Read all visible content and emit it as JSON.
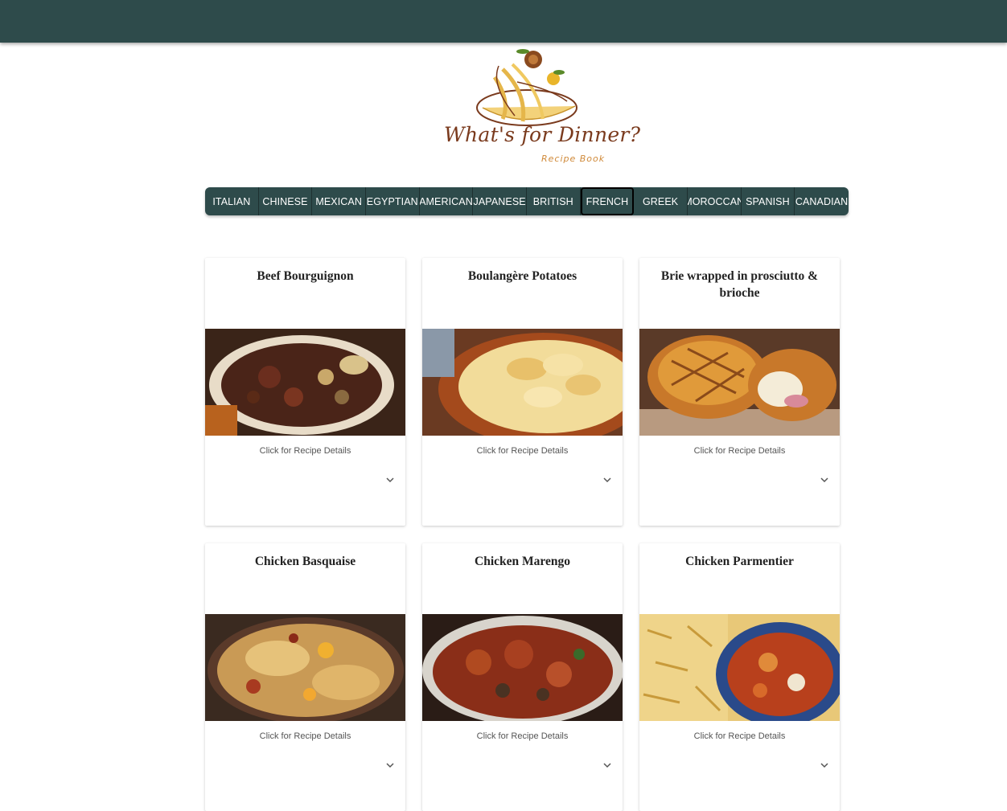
{
  "logo": {
    "title": "What's for Dinner?",
    "subtitle": "Recipe Book"
  },
  "tabs": [
    "ITALIAN",
    "CHINESE",
    "MEXICAN",
    "EGYPTIAN",
    "AMERICAN",
    "JAPANESE",
    "BRITISH",
    "FRENCH",
    "GREEK",
    "MOROCCAN",
    "SPANISH",
    "CANADIAN"
  ],
  "active_tab": "FRENCH",
  "recipes": [
    {
      "title": "Beef Bourguignon",
      "hint": "Click for Recipe Details"
    },
    {
      "title": "Boulangère Potatoes",
      "hint": "Click for Recipe Details"
    },
    {
      "title": "Brie wrapped in prosciutto & brioche",
      "hint": "Click for Recipe Details"
    },
    {
      "title": "Chicken Basquaise",
      "hint": "Click for Recipe Details"
    },
    {
      "title": "Chicken Marengo",
      "hint": "Click for Recipe Details"
    },
    {
      "title": "Chicken Parmentier",
      "hint": "Click for Recipe Details"
    }
  ],
  "colors": {
    "header": "#2e4b4b",
    "tabs": "#2e4b4b",
    "logo_text": "#7a3a1d",
    "logo_sub": "#d08a3a"
  }
}
